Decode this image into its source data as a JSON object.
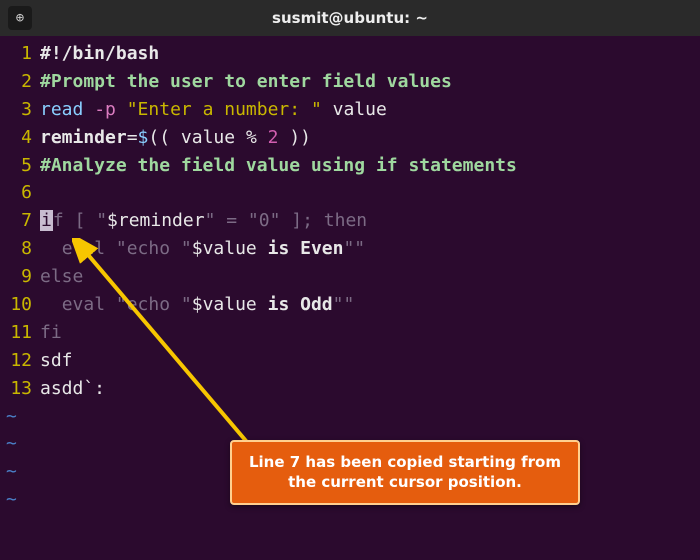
{
  "titlebar": {
    "tab_glyph": "⊕",
    "title": "susmit@ubuntu: ~"
  },
  "lines": [
    {
      "n": "1",
      "tokens": [
        {
          "c": "c-white bold",
          "t": "#!/bin/bash"
        }
      ]
    },
    {
      "n": "2",
      "tokens": [
        {
          "c": "c-comment bold",
          "t": "#Prompt the user to enter field values"
        }
      ]
    },
    {
      "n": "3",
      "tokens": [
        {
          "c": "c-cmd",
          "t": "read "
        },
        {
          "c": "c-flag",
          "t": "-p"
        },
        {
          "c": "c-white",
          "t": " "
        },
        {
          "c": "c-str",
          "t": "\"Enter a number: \""
        },
        {
          "c": "c-white",
          "t": " value"
        }
      ]
    },
    {
      "n": "4",
      "tokens": [
        {
          "c": "c-white bold",
          "t": "reminder"
        },
        {
          "c": "c-punct",
          "t": "="
        },
        {
          "c": "c-cmd",
          "t": "$"
        },
        {
          "c": "c-punct",
          "t": "(("
        },
        {
          "c": "c-white",
          "t": " value "
        },
        {
          "c": "c-punct",
          "t": "% "
        },
        {
          "c": "c-num",
          "t": "2"
        },
        {
          "c": "c-white",
          "t": " "
        },
        {
          "c": "c-punct",
          "t": "))"
        }
      ]
    },
    {
      "n": "5",
      "tokens": [
        {
          "c": "c-comment bold",
          "t": "#Analyze the field value using if statements"
        }
      ]
    },
    {
      "n": "6",
      "tokens": []
    },
    {
      "n": "7",
      "tokens": [
        {
          "c": "cursor-block",
          "t": "i"
        },
        {
          "c": "c-dim",
          "t": "f [ \""
        },
        {
          "c": "c-white",
          "t": "$reminder"
        },
        {
          "c": "c-dim",
          "t": "\" = \"0\" ]; then"
        }
      ]
    },
    {
      "n": "8",
      "tokens": [
        {
          "c": "c-white",
          "t": "  "
        },
        {
          "c": "c-dim",
          "t": "eval \"echo \""
        },
        {
          "c": "c-white",
          "t": "$value"
        },
        {
          "c": "c-white bold",
          "t": " is Even"
        },
        {
          "c": "c-dim",
          "t": "\"\""
        }
      ]
    },
    {
      "n": "9",
      "tokens": [
        {
          "c": "c-dim",
          "t": "else"
        }
      ]
    },
    {
      "n": "10",
      "tokens": [
        {
          "c": "c-white",
          "t": "  "
        },
        {
          "c": "c-dim",
          "t": "eval \"echo \""
        },
        {
          "c": "c-white",
          "t": "$value"
        },
        {
          "c": "c-white bold",
          "t": " is Odd"
        },
        {
          "c": "c-dim",
          "t": "\"\""
        }
      ]
    },
    {
      "n": "11",
      "tokens": [
        {
          "c": "c-dim",
          "t": "fi"
        }
      ]
    },
    {
      "n": "12",
      "tokens": [
        {
          "c": "c-white",
          "t": "sdf"
        }
      ]
    },
    {
      "n": "13",
      "tokens": [
        {
          "c": "c-white",
          "t": "asdd`:"
        }
      ]
    }
  ],
  "tilde": "~",
  "tilde_count": 4,
  "callout": {
    "line1": "Line 7 has been copied starting from",
    "line2": "the current cursor position."
  },
  "arrow_color": "#f7c600"
}
